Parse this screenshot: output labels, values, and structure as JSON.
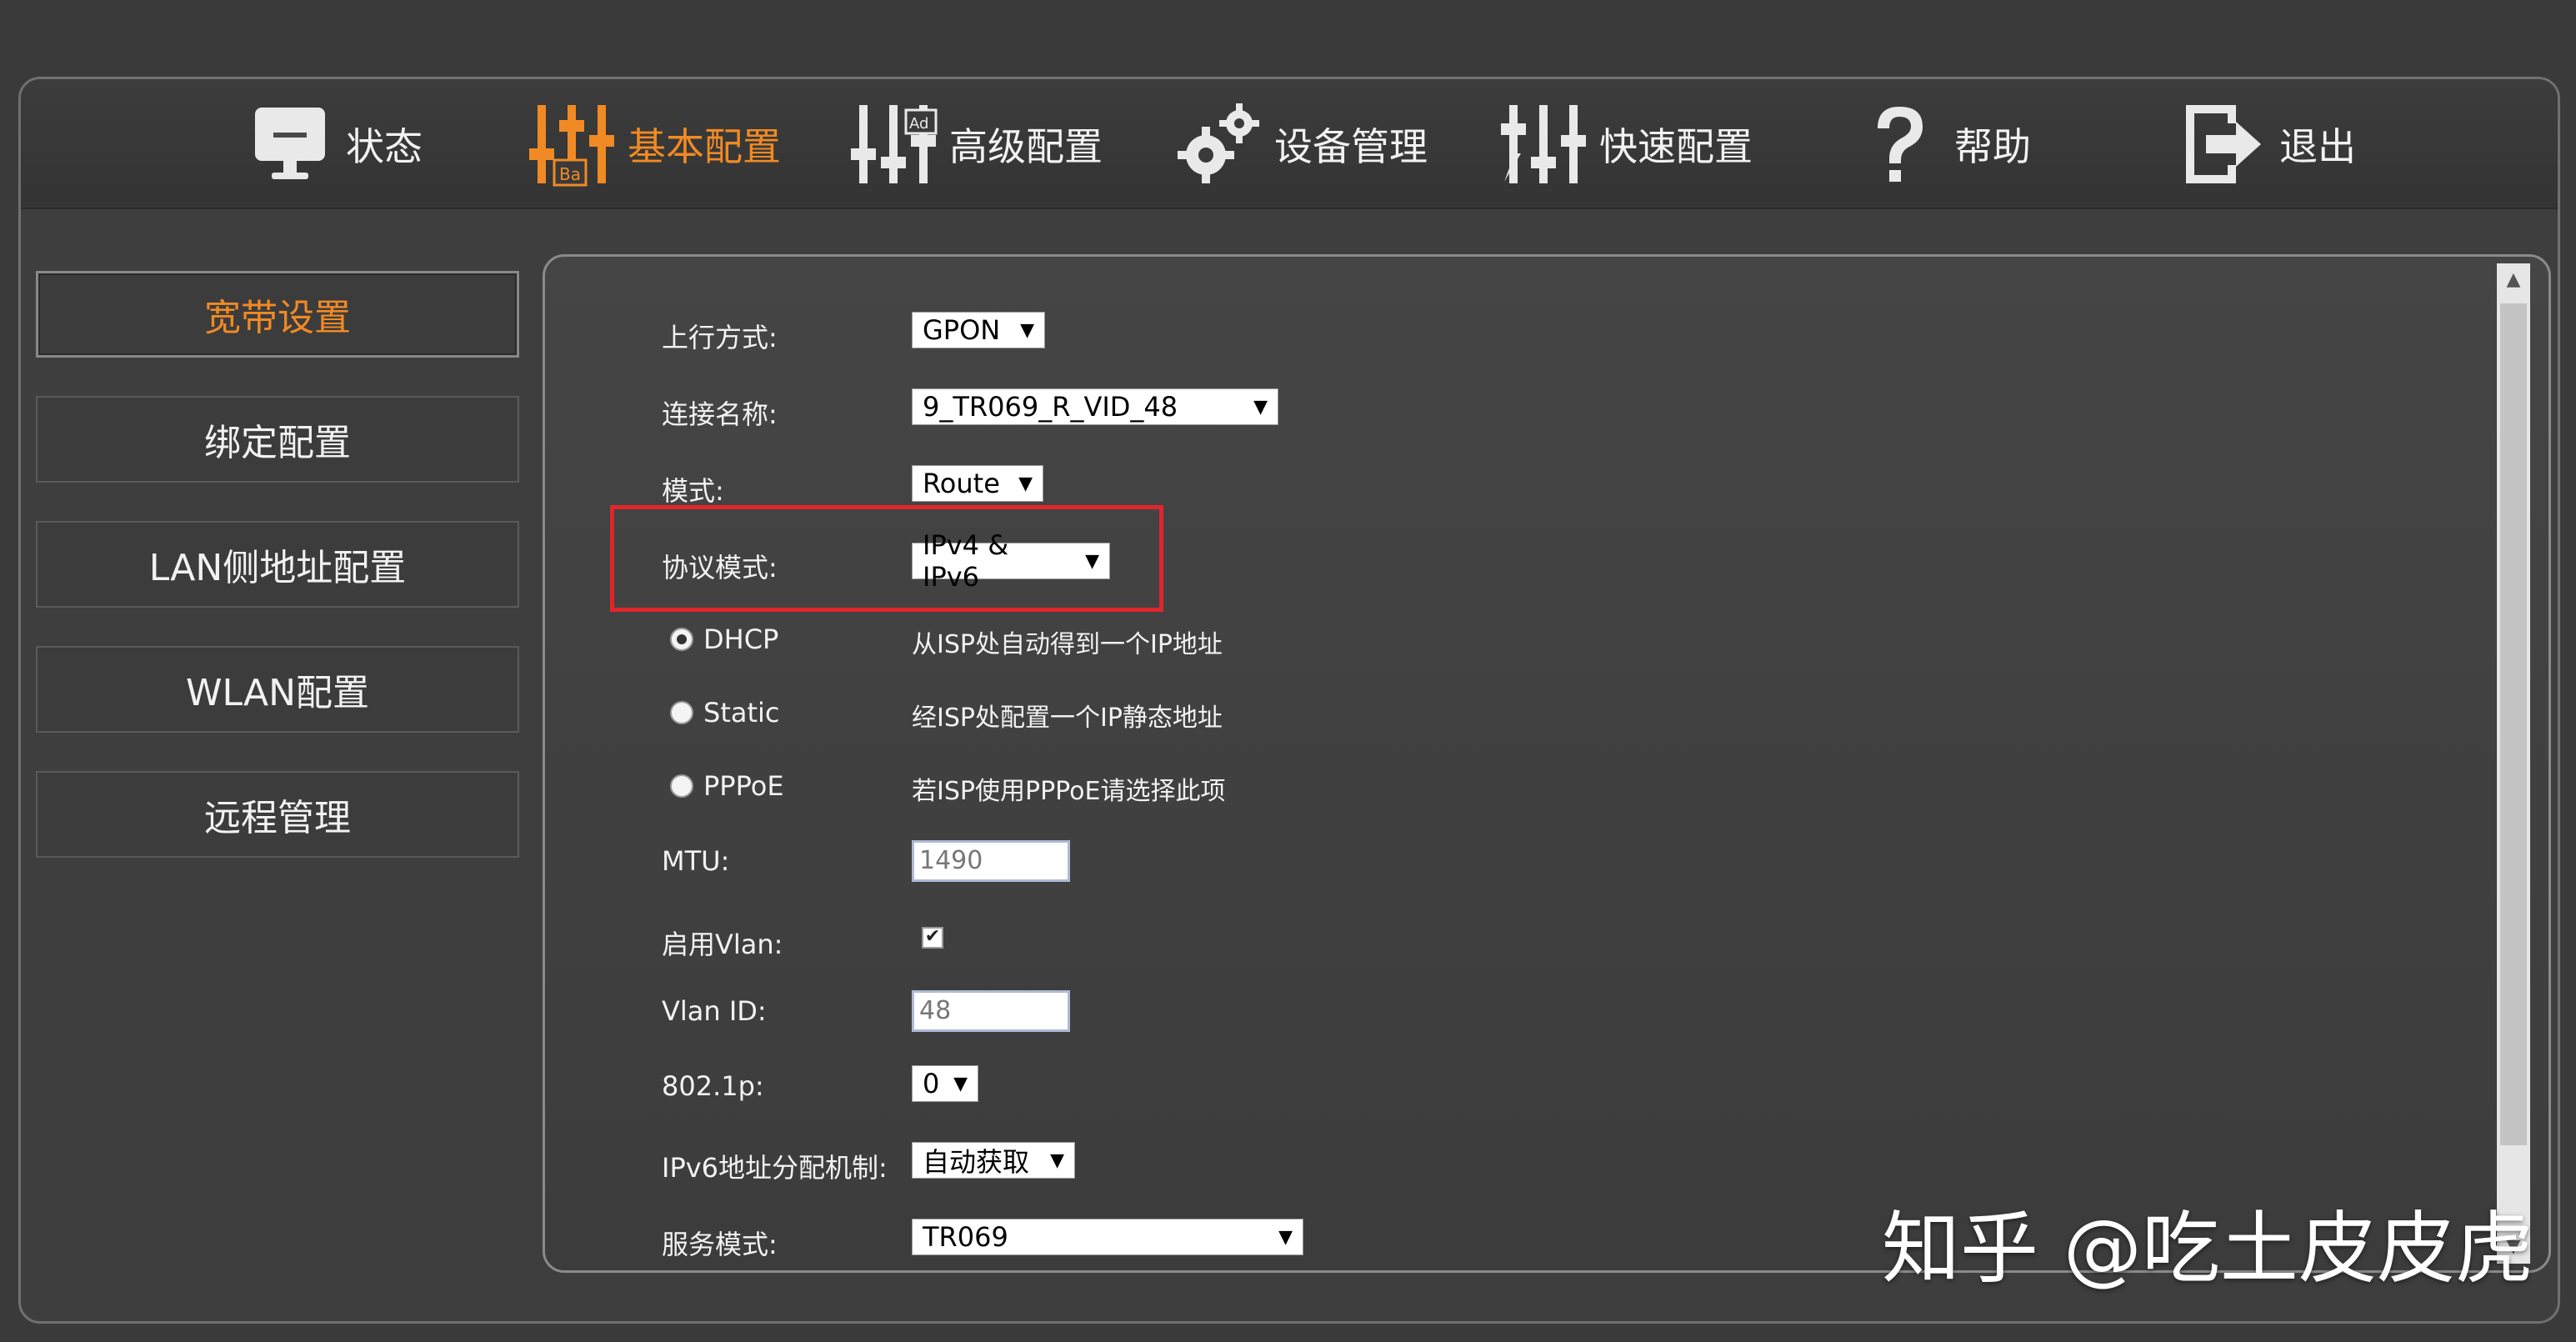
{
  "nav": {
    "items": [
      {
        "label": "状态",
        "icon": "monitor-icon"
      },
      {
        "label": "基本配置",
        "icon": "sliders-ba-icon"
      },
      {
        "label": "高级配置",
        "icon": "sliders-ad-icon"
      },
      {
        "label": "设备管理",
        "icon": "gears-icon"
      },
      {
        "label": "快速配置",
        "icon": "sliders-bolt-icon"
      },
      {
        "label": "帮助",
        "icon": "question-icon"
      },
      {
        "label": "退出",
        "icon": "exit-icon"
      }
    ],
    "active_index": 1,
    "active_color": "#f08a24"
  },
  "sidebar": {
    "items": [
      {
        "label": "宽带设置"
      },
      {
        "label": "绑定配置"
      },
      {
        "label": "LAN侧地址配置"
      },
      {
        "label": "WLAN配置"
      },
      {
        "label": "远程管理"
      }
    ],
    "active_index": 0
  },
  "form": {
    "uplink_label": "上行方式:",
    "uplink_value": "GPON",
    "connection_label": "连接名称:",
    "connection_value": "9_TR069_R_VID_48",
    "mode_label": "模式:",
    "mode_value": "Route",
    "protocol_label": "协议模式:",
    "protocol_value": "IPv4 & IPv6",
    "dhcp_label": "DHCP",
    "dhcp_desc": "从ISP处自动得到一个IP地址",
    "static_label": "Static",
    "static_desc": "经ISP处配置一个IP静态地址",
    "pppoe_label": "PPPoE",
    "pppoe_desc": "若ISP使用PPPoE请选择此项",
    "mtu_label": "MTU:",
    "mtu_value": "1490",
    "vlan_enable_label": "启用Vlan:",
    "vlan_enabled": true,
    "vlan_id_label": "Vlan ID:",
    "vlan_id_value": "48",
    "p8021_label": "802.1p:",
    "p8021_value": "0",
    "ipv6_alloc_label": "IPv6地址分配机制:",
    "ipv6_alloc_value": "自动获取",
    "service_label": "服务模式:",
    "service_value": "TR069",
    "highlight_color": "#e0262b"
  },
  "watermark": "知乎 @吃土皮皮虎"
}
